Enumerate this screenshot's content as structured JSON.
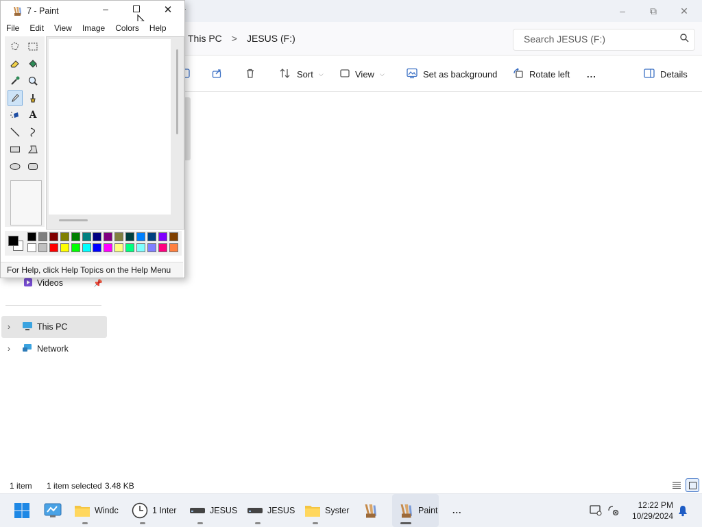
{
  "explorer": {
    "breadcrumb": [
      "This PC",
      "JESUS (F:)"
    ],
    "breadcrumb_sep": ">",
    "search_placeholder": "Search JESUS (F:)",
    "toolbar": {
      "sort": "Sort",
      "view": "View",
      "set_background": "Set as background",
      "rotate_left": "Rotate left",
      "more": "...",
      "details": "Details"
    },
    "nav": {
      "videos": "Videos",
      "this_pc": "This PC",
      "network": "Network"
    },
    "status": {
      "count": "1 item",
      "selected": "1 item selected",
      "size": "3.48 KB"
    },
    "new_tab": "+"
  },
  "paint": {
    "title": "7 - Paint",
    "menu": [
      "File",
      "Edit",
      "View",
      "Image",
      "Colors",
      "Help"
    ],
    "status": "For Help, click Help Topics on the Help Menu",
    "palette_top": [
      "#000000",
      "#808080",
      "#800000",
      "#808000",
      "#008000",
      "#008080",
      "#000080",
      "#800080",
      "#808040",
      "#004040",
      "#0080ff",
      "#004080",
      "#8000ff",
      "#804000"
    ],
    "palette_bottom": [
      "#ffffff",
      "#c0c0c0",
      "#ff0000",
      "#ffff00",
      "#00ff00",
      "#00ffff",
      "#0000ff",
      "#ff00ff",
      "#ffff80",
      "#00ff80",
      "#80ffff",
      "#8080ff",
      "#ff0080",
      "#ff8040"
    ],
    "primary_color": "#000000",
    "secondary_color": "#ffffff"
  },
  "taskbar": {
    "items": [
      {
        "label": "Windc"
      },
      {
        "label": "1 Inter"
      },
      {
        "label": "JESUS"
      },
      {
        "label": "JESUS"
      },
      {
        "label": "Syster"
      },
      {
        "label": ""
      },
      {
        "label": "Paint"
      }
    ],
    "more": "...",
    "time": "12:22 PM",
    "date": "10/29/2024"
  }
}
